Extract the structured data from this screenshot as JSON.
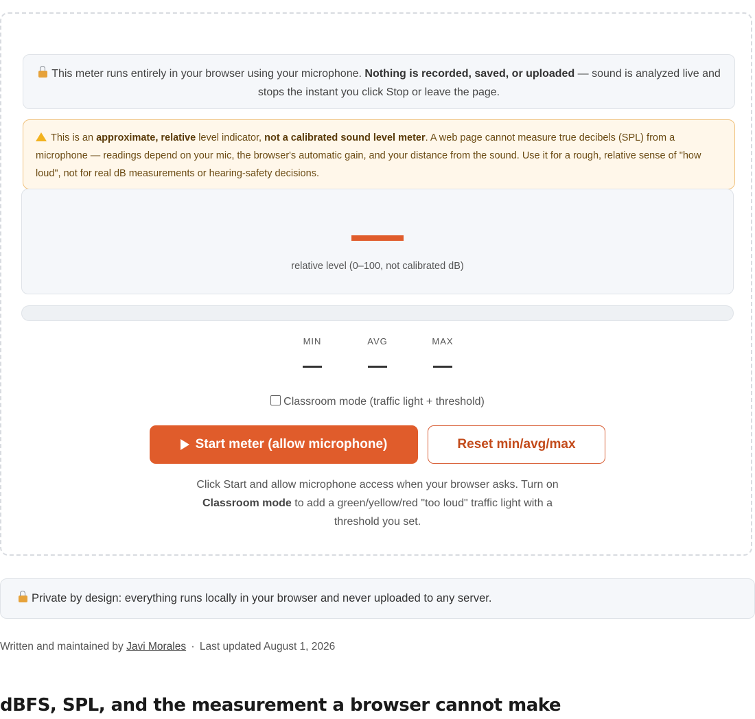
{
  "privacy_note": {
    "lead": "This meter runs entirely in your browser using your microphone.",
    "emphasis": "Nothing is recorded, saved, or uploaded",
    "tail": "— sound is analyzed live and stops the instant you click Stop or leave the page."
  },
  "warning_note": {
    "t1": "This is an",
    "b1": "approximate, relative",
    "t2": "level indicator,",
    "b2": "not a calibrated sound level meter",
    "t3": ". A web page cannot measure true decibels (SPL) from a microphone — readings depend on your mic, the browser's automatic gain, and your distance from the sound. Use it for a rough, relative sense of \"how loud\", not for real dB measurements or hearing-safety decisions."
  },
  "meter": {
    "caption": "relative level (0–100, not calibrated dB)",
    "level_fraction": 0,
    "accent_color": "#e05c2b"
  },
  "stats": [
    {
      "label": "MIN",
      "value": "—"
    },
    {
      "label": "AVG",
      "value": "—"
    },
    {
      "label": "MAX",
      "value": "—"
    }
  ],
  "classroom_mode": {
    "label": "Classroom mode (traffic light + threshold)",
    "checked": false
  },
  "buttons": {
    "start": "Start meter (allow microphone)",
    "reset": "Reset min/avg/max"
  },
  "help": {
    "t1": "Click Start and allow microphone access when your browser asks. Turn on",
    "b1": "Classroom mode",
    "t2": "to add a green/yellow/red \"too loud\" traffic light with a threshold you set."
  },
  "private_banner": "Private by design: everything runs locally in your browser and never uploaded to any server.",
  "byline": {
    "prefix": "Written and maintained by",
    "author": "Javi Morales",
    "separator": "·",
    "updated": "Last updated August 1, 2026"
  },
  "section_heading": "dBFS, SPL, and the measurement a browser cannot make"
}
